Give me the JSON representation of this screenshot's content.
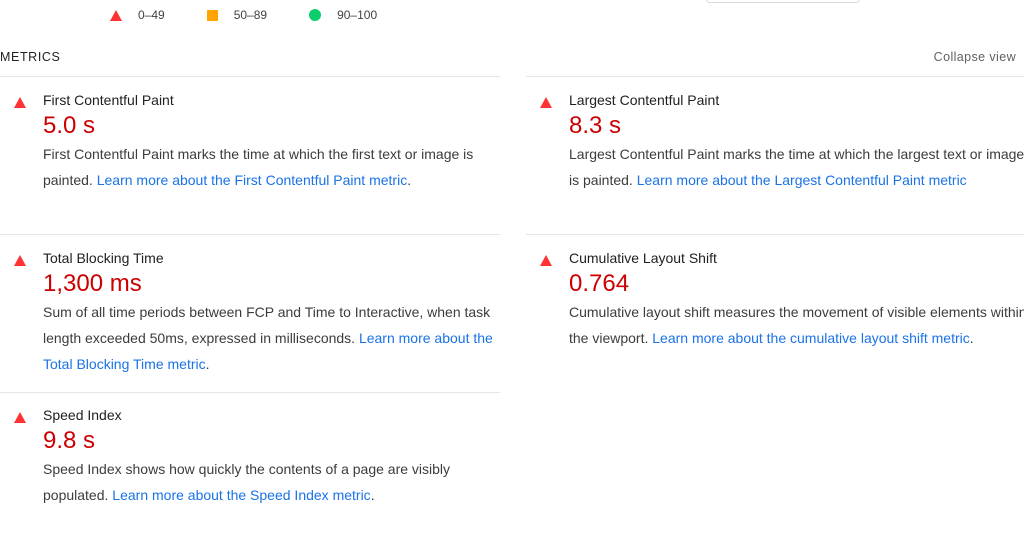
{
  "legend": [
    {
      "icon": "triangle-red-icon",
      "label": "0–49",
      "color": "#ff3333"
    },
    {
      "icon": "square-orange-icon",
      "label": "50–89",
      "color": "#ffa400"
    },
    {
      "icon": "circle-green-icon",
      "label": "90–100",
      "color": "#0cce6b"
    }
  ],
  "header": {
    "title": "METRICS",
    "collapse_label": "Collapse view"
  },
  "metrics": {
    "fcp": {
      "title": "First Contentful Paint",
      "value": "5.0 s",
      "description": "First Contentful Paint marks the time at which the first text or image is painted. ",
      "link": "Learn more about the First Contentful Paint metric",
      "trailing": "."
    },
    "lcp": {
      "title": "Largest Contentful Paint",
      "value": "8.3 s",
      "description": "Largest Contentful Paint marks the time at which the largest text or image is painted. ",
      "link": "Learn more about the Largest Contentful Paint metric",
      "trailing": ""
    },
    "tbt": {
      "title": "Total Blocking Time",
      "value": "1,300 ms",
      "description": "Sum of all time periods between FCP and Time to Interactive, when task length exceeded 50ms, expressed in milliseconds. ",
      "link": "Learn more about the Total Blocking Time metric",
      "trailing": "."
    },
    "cls": {
      "title": "Cumulative Layout Shift",
      "value": "0.764",
      "description": "Cumulative layout shift measures the movement of visible elements within the viewport. ",
      "link": "Learn more about the cumulative layout shift metric",
      "trailing": "."
    },
    "si": {
      "title": "Speed Index",
      "value": "9.8 s",
      "description": "Speed Index shows how quickly the contents of a page are visibly populated. ",
      "link": "Learn more about the Speed Index metric",
      "trailing": "."
    }
  },
  "colors": {
    "fail": "#cc0000",
    "fail_icon": "#ff3333",
    "link": "#1a73e8"
  }
}
